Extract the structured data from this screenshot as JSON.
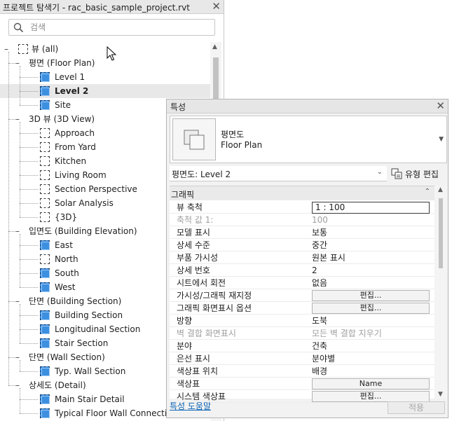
{
  "browser": {
    "title": "프로젝트 탐색기 - rac_basic_sample_project.rvt",
    "close_glyph": "✕",
    "search_placeholder": "검색",
    "tree": [
      {
        "label": "뷰 (all)",
        "level": 0,
        "toggle": "–",
        "icon": "root"
      },
      {
        "label": "평면 (Floor Plan)",
        "level": 1,
        "toggle": "–"
      },
      {
        "label": "Level 1",
        "level": 2,
        "icon": "filled"
      },
      {
        "label": "Level 2",
        "level": 2,
        "icon": "filled",
        "selected": true
      },
      {
        "label": "Site",
        "level": 2,
        "icon": "filled"
      },
      {
        "label": "3D 뷰 (3D View)",
        "level": 1,
        "toggle": "–"
      },
      {
        "label": "Approach",
        "level": 2,
        "icon": "empty"
      },
      {
        "label": "From Yard",
        "level": 2,
        "icon": "empty"
      },
      {
        "label": "Kitchen",
        "level": 2,
        "icon": "empty"
      },
      {
        "label": "Living Room",
        "level": 2,
        "icon": "empty"
      },
      {
        "label": "Section Perspective",
        "level": 2,
        "icon": "empty"
      },
      {
        "label": "Solar Analysis",
        "level": 2,
        "icon": "empty"
      },
      {
        "label": "{3D}",
        "level": 2,
        "icon": "empty"
      },
      {
        "label": "입면도 (Building Elevation)",
        "level": 1,
        "toggle": "–"
      },
      {
        "label": "East",
        "level": 2,
        "icon": "filled"
      },
      {
        "label": "North",
        "level": 2,
        "icon": "empty"
      },
      {
        "label": "South",
        "level": 2,
        "icon": "filled"
      },
      {
        "label": "West",
        "level": 2,
        "icon": "filled"
      },
      {
        "label": "단면 (Building Section)",
        "level": 1,
        "toggle": "–"
      },
      {
        "label": "Building Section",
        "level": 2,
        "icon": "filled"
      },
      {
        "label": "Longitudinal Section",
        "level": 2,
        "icon": "filled"
      },
      {
        "label": "Stair Section",
        "level": 2,
        "icon": "filled"
      },
      {
        "label": "단면 (Wall Section)",
        "level": 1,
        "toggle": "–"
      },
      {
        "label": "Typ. Wall Section",
        "level": 2,
        "icon": "filled"
      },
      {
        "label": "상세도 (Detail)",
        "level": 1,
        "toggle": "–"
      },
      {
        "label": "Main Stair Detail",
        "level": 2,
        "icon": "filled"
      },
      {
        "label": "Typical Floor Wall Connection",
        "level": 2,
        "icon": "filled"
      }
    ]
  },
  "props": {
    "title": "특성",
    "close_glyph": "✕",
    "type_name_line1": "평면도",
    "type_name_line2": "Floor Plan",
    "instance_filter": "평면도: Level 2",
    "edit_type_label": "유형 편집",
    "group_label": "그래픽",
    "rows": [
      {
        "name": "뷰 축척",
        "value": "1 : 100",
        "kind": "input"
      },
      {
        "name": "축척 값    1:",
        "value": "100",
        "kind": "text",
        "disabled": true
      },
      {
        "name": "모델 표시",
        "value": "보통",
        "kind": "text"
      },
      {
        "name": "상세 수준",
        "value": "중간",
        "kind": "text"
      },
      {
        "name": "부품 가시성",
        "value": "원본 표시",
        "kind": "text"
      },
      {
        "name": "상세 번호",
        "value": "2",
        "kind": "text"
      },
      {
        "name": "시트에서 회전",
        "value": "없음",
        "kind": "text"
      },
      {
        "name": "가시성/그래픽 재지정",
        "value": "편집...",
        "kind": "button"
      },
      {
        "name": "그래픽 화면표시 옵션",
        "value": "편집...",
        "kind": "button"
      },
      {
        "name": "방향",
        "value": "도북",
        "kind": "text"
      },
      {
        "name": "벽 결합 화면표시",
        "value": "모든 벽 결합 지우기",
        "kind": "text",
        "disabled": true
      },
      {
        "name": "분야",
        "value": "건축",
        "kind": "text"
      },
      {
        "name": "은선 표시",
        "value": "분야별",
        "kind": "text"
      },
      {
        "name": "색상표 위치",
        "value": "배경",
        "kind": "text"
      },
      {
        "name": "색상표",
        "value": "Name",
        "kind": "button"
      },
      {
        "name": "시스템 색상표",
        "value": "편집...",
        "kind": "button"
      }
    ],
    "help_link": "특성 도움말",
    "apply_label": "적용"
  },
  "colors": {
    "view_icon_fill": "#3d8fe0",
    "link": "#0a62b4",
    "selected_row": "#e8e8e8"
  },
  "icons": [
    "search-icon",
    "view-icon",
    "floor-plan-type-icon",
    "edit-type-icon",
    "mouse-pointer-icon"
  ]
}
